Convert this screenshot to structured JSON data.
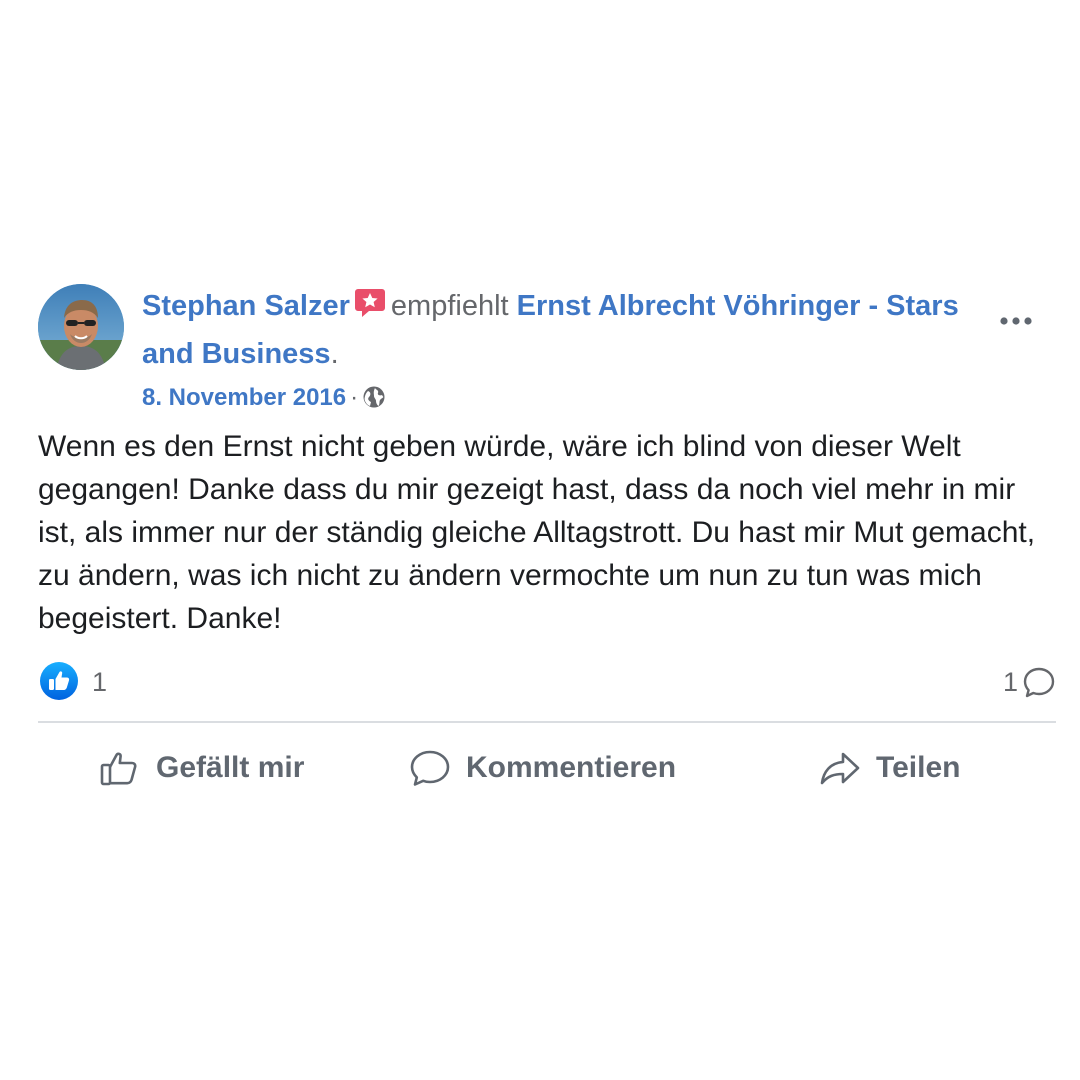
{
  "post": {
    "author": "Stephan Salzer",
    "verb": "empfiehlt",
    "page_name": "Ernst Albrecht Vöhringer - Stars and Business",
    "trailing_period": ".",
    "date": "8. November 2016",
    "separator": "·",
    "body": "Wenn es den Ernst nicht geben würde, wäre ich blind von dieser Welt gegangen! Danke dass du mir gezeigt hast, dass da noch viel mehr in mir ist, als immer nur der ständig gleiche Alltagstrott. Du hast mir Mut gemacht, zu ändern, was ich nicht zu ändern vermochte um nun zu tun was mich begeistert. Danke!"
  },
  "stats": {
    "like_count": "1",
    "comment_count": "1"
  },
  "actions": {
    "like_label": "Gefällt mir",
    "comment_label": "Kommentieren",
    "share_label": "Teilen"
  },
  "icons": {
    "recommend": "recommend-star-icon",
    "audience": "globe-icon",
    "more": "more-options-icon",
    "like_reaction": "like-reaction-icon",
    "comment": "comment-icon",
    "thumbs_up": "thumbs-up-icon",
    "share": "share-arrow-icon"
  },
  "colors": {
    "link": "#3f77c5",
    "like_blue": "#1877f2",
    "recommend_red": "#e94e6a",
    "muted": "#65676b",
    "text": "#1c1e21"
  }
}
